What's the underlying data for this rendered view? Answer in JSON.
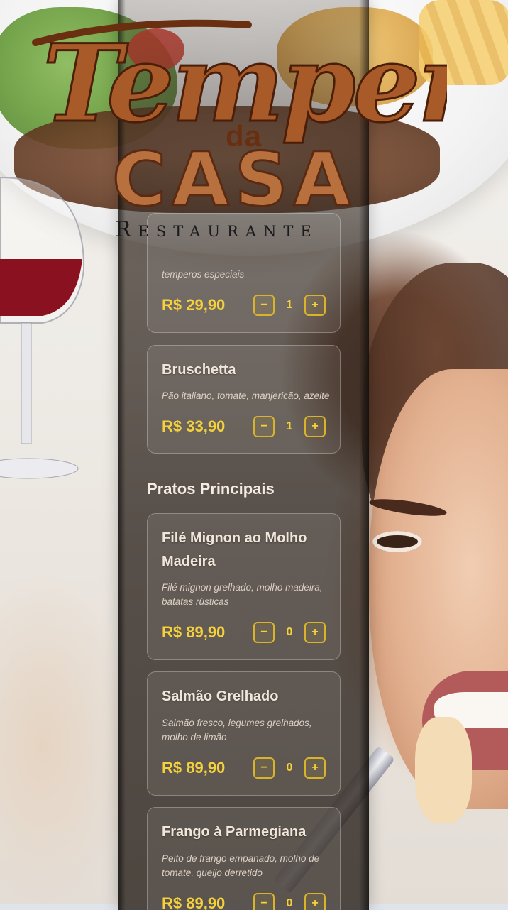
{
  "brand": {
    "script": "Tempero",
    "da": "da",
    "casa": "CASA",
    "subtitle": "Restaurante"
  },
  "menu": {
    "partial_item": {
      "description": "temperos especiais",
      "price": "R$ 29,90",
      "quantity": "1"
    },
    "starters": [
      {
        "name": "Bruschetta",
        "description": "Pão italiano, tomate, manjericão, azeite",
        "price": "R$ 33,90",
        "quantity": "1"
      }
    ],
    "section_main": "Pratos Principais",
    "mains": [
      {
        "name": "Filé Mignon ao Molho Madeira",
        "description": "Filé mignon grelhado, molho madeira, batatas rústicas",
        "price": "R$ 89,90",
        "quantity": "0"
      },
      {
        "name": "Salmão Grelhado",
        "description": "Salmão fresco, legumes grelhados, molho de limão",
        "price": "R$ 89,90",
        "quantity": "0"
      },
      {
        "name": "Frango à Parmegiana",
        "description": "Peito de frango empanado, molho de tomate, queijo derretido",
        "price": "R$ 89,90",
        "quantity": "0"
      }
    ]
  },
  "controls": {
    "minus": "−",
    "plus": "+"
  },
  "colors": {
    "price": "#f5d23b",
    "logo_brown": "#b8703e",
    "logo_dark": "#6a2f10"
  }
}
